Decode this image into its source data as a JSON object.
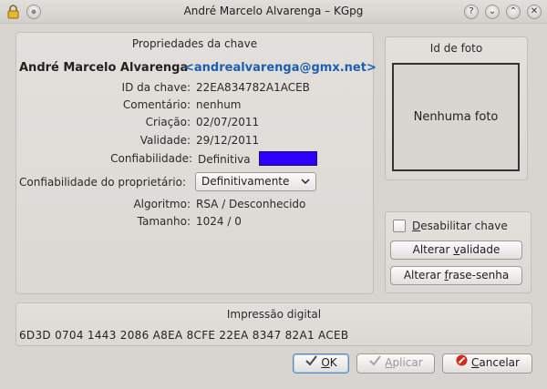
{
  "window": {
    "title": "André Marcelo Alvarenga – KGpg",
    "icons": [
      "lock-icon",
      "menu-icon"
    ],
    "controls": [
      "help-icon",
      "minimize-icon",
      "maximize-icon",
      "close-icon"
    ],
    "help_glyph": "?",
    "minimize_glyph": "⌄",
    "maximize_glyph": "⌃",
    "close_glyph": "✕"
  },
  "props": {
    "title": "Propriedades da chave",
    "owner_name": "André Marcelo Alvarenga",
    "owner_email": "<andrealvarenga@gmx.net>",
    "key_id_label": "ID da chave:",
    "key_id": "22EA834782A1ACEB",
    "comment_label": "Comentário:",
    "comment": "nenhum",
    "creation_label": "Criação:",
    "creation": "02/07/2011",
    "expiration_label": "Validade:",
    "expiration": "29/12/2011",
    "trust_label": "Confiabilidade:",
    "trust": "Definitiva",
    "trust_color": "#2b00ff",
    "owner_trust_label": "Confiabilidade do proprietário:",
    "owner_trust_value": "Definitivamente",
    "algorithm_label": "Algoritmo:",
    "algorithm": "RSA / Desconhecido",
    "size_label": "Tamanho:",
    "size": "1024 / 0"
  },
  "photo": {
    "title": "Id de foto",
    "placeholder": "Nenhuma foto"
  },
  "actions": {
    "disable_prefix": "D",
    "disable_label": "esabilitar chave",
    "change_expiry_prefix": "Alterar ",
    "change_expiry_ul": "v",
    "change_expiry_rest": "alidade",
    "change_pass_prefix": "Alterar ",
    "change_pass_ul": "f",
    "change_pass_rest": "rase-senha"
  },
  "fingerprint": {
    "title": "Impressão digital",
    "value": "6D3D 0704 1443 2086 A8EA 8CFE 22EA 8347 82A1 ACEB"
  },
  "buttons": {
    "ok_ul": "O",
    "ok_rest": "K",
    "apply_ul": "A",
    "apply_rest": "plicar",
    "cancel_ul": "C",
    "cancel_rest": "ancelar"
  }
}
